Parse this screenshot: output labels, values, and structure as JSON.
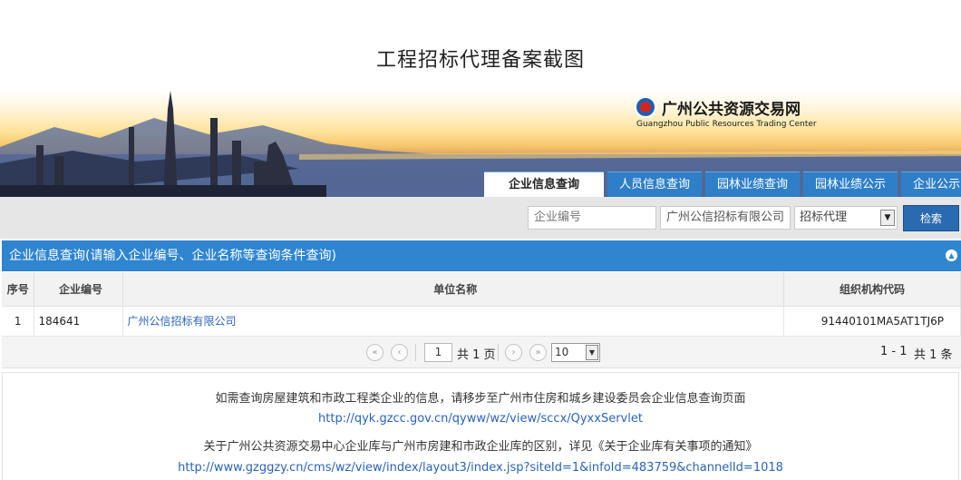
{
  "page": {
    "title": "工程招标代理备案截图"
  },
  "header": {
    "logo_cn": "广州公共资源交易网",
    "logo_en": "Guangzhou Public Resources Trading Center",
    "tabs": [
      {
        "label": "企业信息查询",
        "active": true
      },
      {
        "label": "人员信息查询",
        "active": false
      },
      {
        "label": "园林业绩查询",
        "active": false
      },
      {
        "label": "园林业绩公示",
        "active": false
      },
      {
        "label": "企业公示",
        "active": false
      }
    ]
  },
  "search": {
    "code_placeholder": "企业编号",
    "name_value": "广州公信招标有限公司",
    "type_selected": "招标代理",
    "button_label": "检索"
  },
  "panel": {
    "title": "企业信息查询(请输入企业编号、企业名称等查询条件查询)"
  },
  "table": {
    "columns": [
      "序号",
      "企业编号",
      "单位名称",
      "组织机构代码"
    ],
    "rows": [
      {
        "idx": "1",
        "code": "184641",
        "name": "广州公信招标有限公司",
        "org_code": "91440101MA5AT1TJ6P"
      }
    ]
  },
  "pager": {
    "current_page": "1",
    "total_pages_text": "共 1 页",
    "page_size": "10",
    "range_text": "1 - 1",
    "total_text": "共 1 条"
  },
  "notice": {
    "line1": "如需查询房屋建筑和市政工程类企业的信息，请移步至广州市住房和城乡建设委员会企业信息查询页面",
    "link1": "http://qyk.gzcc.gov.cn/qyww/wz/view/sccx/QyxxServlet",
    "line2": "关于广州公共资源交易中心企业库与广州市房建和市政企业库的区别，详见《关于企业库有关事项的通知》",
    "link2": "http://www.gzggzy.cn/cms/wz/view/index/layout3/index.jsp?siteId=1&infoId=483759&channelId=1018"
  },
  "colors": {
    "accent": "#2f85d0",
    "tab": "#2f7fc8",
    "link": "#2a63b8"
  },
  "icons": {
    "first_page": "double-chevron-left-icon",
    "prev_page": "chevron-left-icon",
    "next_page": "chevron-right-icon",
    "last_page": "double-chevron-right-icon",
    "collapse": "chevron-up-icon",
    "dropdown": "triangle-down-icon"
  }
}
